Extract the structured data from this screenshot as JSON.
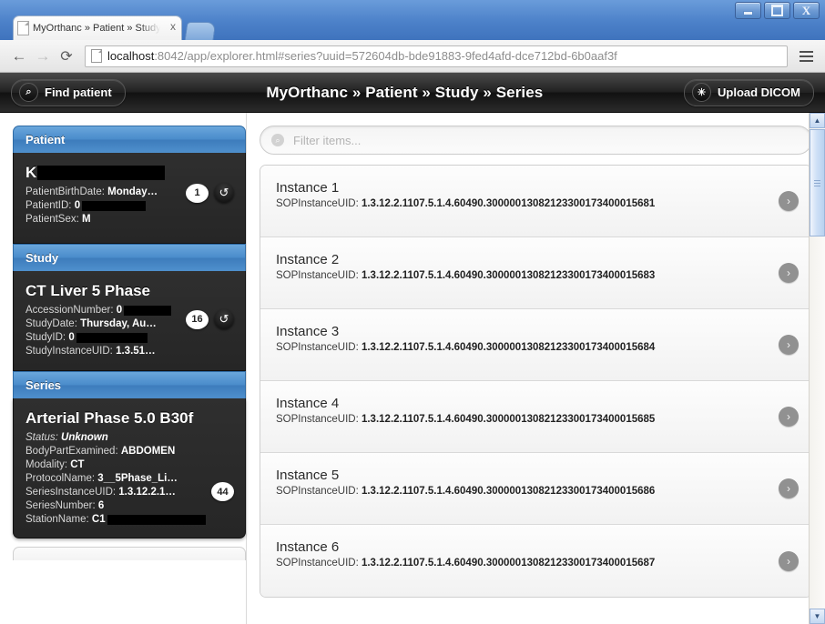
{
  "window": {
    "minimize_label": "Minimize",
    "maximize_label": "Maximize",
    "close_label": "Close"
  },
  "browser": {
    "tab_title": "MyOrthanc » Patient » Study",
    "tab_close_label": "x",
    "back_icon": "←",
    "forward_icon": "→",
    "reload_icon": "⟳",
    "menu_icon": "hamburger-icon",
    "url_host": "localhost",
    "url_path": ":8042/app/explorer.html#series?uuid=572604db-bde91883-9fed4afd-dce712bd-6b0aaf3f"
  },
  "appheader": {
    "find_patient_label": "Find patient",
    "find_patient_icon": "⌕",
    "title": "MyOrthanc » Patient » Study » Series",
    "upload_label": "Upload DICOM",
    "upload_icon": "✳"
  },
  "panels": [
    {
      "header": "Patient",
      "title_prefix": "K",
      "title_redacted_width": 140,
      "fields": [
        {
          "key": "PatientBirthDate:",
          "value": "Monday…",
          "redacted_width": 0
        },
        {
          "key": "PatientID:",
          "value": "0",
          "redacted_width": 70
        },
        {
          "key": "PatientSex:",
          "value": "M",
          "redacted_width": 0
        }
      ],
      "badge_count": "1",
      "badge_refresh_icon": "↺"
    },
    {
      "header": "Study",
      "title_prefix": "CT Liver 5 Phase",
      "title_redacted_width": 0,
      "fields": [
        {
          "key": "AccessionNumber:",
          "value": "0",
          "redacted_width": 52
        },
        {
          "key": "StudyDate:",
          "value": "Thursday, Au…",
          "redacted_width": 0
        },
        {
          "key": "StudyID:",
          "value": "0",
          "redacted_width": 78
        },
        {
          "key": "StudyInstanceUID:",
          "value": "1.3.51…",
          "redacted_width": 0
        }
      ],
      "badge_count": "16",
      "badge_refresh_icon": "↺"
    },
    {
      "header": "Series",
      "title_prefix": "Arterial Phase 5.0 B30f",
      "title_redacted_width": 0,
      "fields": [
        {
          "key": "Status:",
          "value": "Unknown",
          "italic": true,
          "redacted_width": 0
        },
        {
          "key": "BodyPartExamined:",
          "value": "ABDOMEN",
          "redacted_width": 0
        },
        {
          "key": "Modality:",
          "value": "CT",
          "redacted_width": 0
        },
        {
          "key": "ProtocolName:",
          "value": "3__5Phase_Li…",
          "redacted_width": 0
        },
        {
          "key": "SeriesInstanceUID:",
          "value": "1.3.12.2.1…",
          "redacted_width": 0
        },
        {
          "key": "SeriesNumber:",
          "value": "6",
          "redacted_width": 0
        },
        {
          "key": "StationName:",
          "value": "C1",
          "redacted_width": 108
        }
      ],
      "badge_count": "44",
      "badge_refresh_icon": ""
    }
  ],
  "filter": {
    "placeholder": "Filter items...",
    "value": "",
    "icon": "search-icon"
  },
  "instances": [
    {
      "title": "Instance 1",
      "uid_label": "SOPInstanceUID:",
      "uid": "1.3.12.2.1107.5.1.4.60490.30000013082123300173400015681",
      "chevron": "›"
    },
    {
      "title": "Instance 2",
      "uid_label": "SOPInstanceUID:",
      "uid": "1.3.12.2.1107.5.1.4.60490.30000013082123300173400015683",
      "chevron": "›"
    },
    {
      "title": "Instance 3",
      "uid_label": "SOPInstanceUID:",
      "uid": "1.3.12.2.1107.5.1.4.60490.30000013082123300173400015684",
      "chevron": "›"
    },
    {
      "title": "Instance 4",
      "uid_label": "SOPInstanceUID:",
      "uid": "1.3.12.2.1107.5.1.4.60490.30000013082123300173400015685",
      "chevron": "›"
    },
    {
      "title": "Instance 5",
      "uid_label": "SOPInstanceUID:",
      "uid": "1.3.12.2.1107.5.1.4.60490.30000013082123300173400015686",
      "chevron": "›"
    },
    {
      "title": "Instance 6",
      "uid_label": "SOPInstanceUID:",
      "uid": "1.3.12.2.1107.5.1.4.60490.30000013082123300173400015687",
      "chevron": "›"
    }
  ],
  "scrollbar": {
    "up_arrow": "▲",
    "down_arrow": "▼"
  },
  "colors": {
    "panel_header_blue": "#4a8ccb",
    "panel_body_dark": "#2b2b2b",
    "app_header_dark": "#1d1d1d",
    "chrome_blue": "#4b7fc8",
    "chevron_gray": "#919191"
  }
}
